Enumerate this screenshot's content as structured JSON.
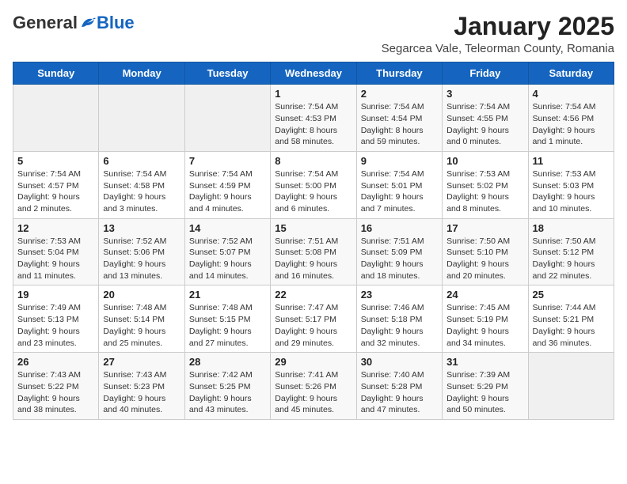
{
  "header": {
    "logo_general": "General",
    "logo_blue": "Blue",
    "month_title": "January 2025",
    "subtitle": "Segarcea Vale, Teleorman County, Romania"
  },
  "weekdays": [
    "Sunday",
    "Monday",
    "Tuesday",
    "Wednesday",
    "Thursday",
    "Friday",
    "Saturday"
  ],
  "weeks": [
    [
      {
        "day": "",
        "info": ""
      },
      {
        "day": "",
        "info": ""
      },
      {
        "day": "",
        "info": ""
      },
      {
        "day": "1",
        "info": "Sunrise: 7:54 AM\nSunset: 4:53 PM\nDaylight: 8 hours and 58 minutes."
      },
      {
        "day": "2",
        "info": "Sunrise: 7:54 AM\nSunset: 4:54 PM\nDaylight: 8 hours and 59 minutes."
      },
      {
        "day": "3",
        "info": "Sunrise: 7:54 AM\nSunset: 4:55 PM\nDaylight: 9 hours and 0 minutes."
      },
      {
        "day": "4",
        "info": "Sunrise: 7:54 AM\nSunset: 4:56 PM\nDaylight: 9 hours and 1 minute."
      }
    ],
    [
      {
        "day": "5",
        "info": "Sunrise: 7:54 AM\nSunset: 4:57 PM\nDaylight: 9 hours and 2 minutes."
      },
      {
        "day": "6",
        "info": "Sunrise: 7:54 AM\nSunset: 4:58 PM\nDaylight: 9 hours and 3 minutes."
      },
      {
        "day": "7",
        "info": "Sunrise: 7:54 AM\nSunset: 4:59 PM\nDaylight: 9 hours and 4 minutes."
      },
      {
        "day": "8",
        "info": "Sunrise: 7:54 AM\nSunset: 5:00 PM\nDaylight: 9 hours and 6 minutes."
      },
      {
        "day": "9",
        "info": "Sunrise: 7:54 AM\nSunset: 5:01 PM\nDaylight: 9 hours and 7 minutes."
      },
      {
        "day": "10",
        "info": "Sunrise: 7:53 AM\nSunset: 5:02 PM\nDaylight: 9 hours and 8 minutes."
      },
      {
        "day": "11",
        "info": "Sunrise: 7:53 AM\nSunset: 5:03 PM\nDaylight: 9 hours and 10 minutes."
      }
    ],
    [
      {
        "day": "12",
        "info": "Sunrise: 7:53 AM\nSunset: 5:04 PM\nDaylight: 9 hours and 11 minutes."
      },
      {
        "day": "13",
        "info": "Sunrise: 7:52 AM\nSunset: 5:06 PM\nDaylight: 9 hours and 13 minutes."
      },
      {
        "day": "14",
        "info": "Sunrise: 7:52 AM\nSunset: 5:07 PM\nDaylight: 9 hours and 14 minutes."
      },
      {
        "day": "15",
        "info": "Sunrise: 7:51 AM\nSunset: 5:08 PM\nDaylight: 9 hours and 16 minutes."
      },
      {
        "day": "16",
        "info": "Sunrise: 7:51 AM\nSunset: 5:09 PM\nDaylight: 9 hours and 18 minutes."
      },
      {
        "day": "17",
        "info": "Sunrise: 7:50 AM\nSunset: 5:10 PM\nDaylight: 9 hours and 20 minutes."
      },
      {
        "day": "18",
        "info": "Sunrise: 7:50 AM\nSunset: 5:12 PM\nDaylight: 9 hours and 22 minutes."
      }
    ],
    [
      {
        "day": "19",
        "info": "Sunrise: 7:49 AM\nSunset: 5:13 PM\nDaylight: 9 hours and 23 minutes."
      },
      {
        "day": "20",
        "info": "Sunrise: 7:48 AM\nSunset: 5:14 PM\nDaylight: 9 hours and 25 minutes."
      },
      {
        "day": "21",
        "info": "Sunrise: 7:48 AM\nSunset: 5:15 PM\nDaylight: 9 hours and 27 minutes."
      },
      {
        "day": "22",
        "info": "Sunrise: 7:47 AM\nSunset: 5:17 PM\nDaylight: 9 hours and 29 minutes."
      },
      {
        "day": "23",
        "info": "Sunrise: 7:46 AM\nSunset: 5:18 PM\nDaylight: 9 hours and 32 minutes."
      },
      {
        "day": "24",
        "info": "Sunrise: 7:45 AM\nSunset: 5:19 PM\nDaylight: 9 hours and 34 minutes."
      },
      {
        "day": "25",
        "info": "Sunrise: 7:44 AM\nSunset: 5:21 PM\nDaylight: 9 hours and 36 minutes."
      }
    ],
    [
      {
        "day": "26",
        "info": "Sunrise: 7:43 AM\nSunset: 5:22 PM\nDaylight: 9 hours and 38 minutes."
      },
      {
        "day": "27",
        "info": "Sunrise: 7:43 AM\nSunset: 5:23 PM\nDaylight: 9 hours and 40 minutes."
      },
      {
        "day": "28",
        "info": "Sunrise: 7:42 AM\nSunset: 5:25 PM\nDaylight: 9 hours and 43 minutes."
      },
      {
        "day": "29",
        "info": "Sunrise: 7:41 AM\nSunset: 5:26 PM\nDaylight: 9 hours and 45 minutes."
      },
      {
        "day": "30",
        "info": "Sunrise: 7:40 AM\nSunset: 5:28 PM\nDaylight: 9 hours and 47 minutes."
      },
      {
        "day": "31",
        "info": "Sunrise: 7:39 AM\nSunset: 5:29 PM\nDaylight: 9 hours and 50 minutes."
      },
      {
        "day": "",
        "info": ""
      }
    ]
  ]
}
